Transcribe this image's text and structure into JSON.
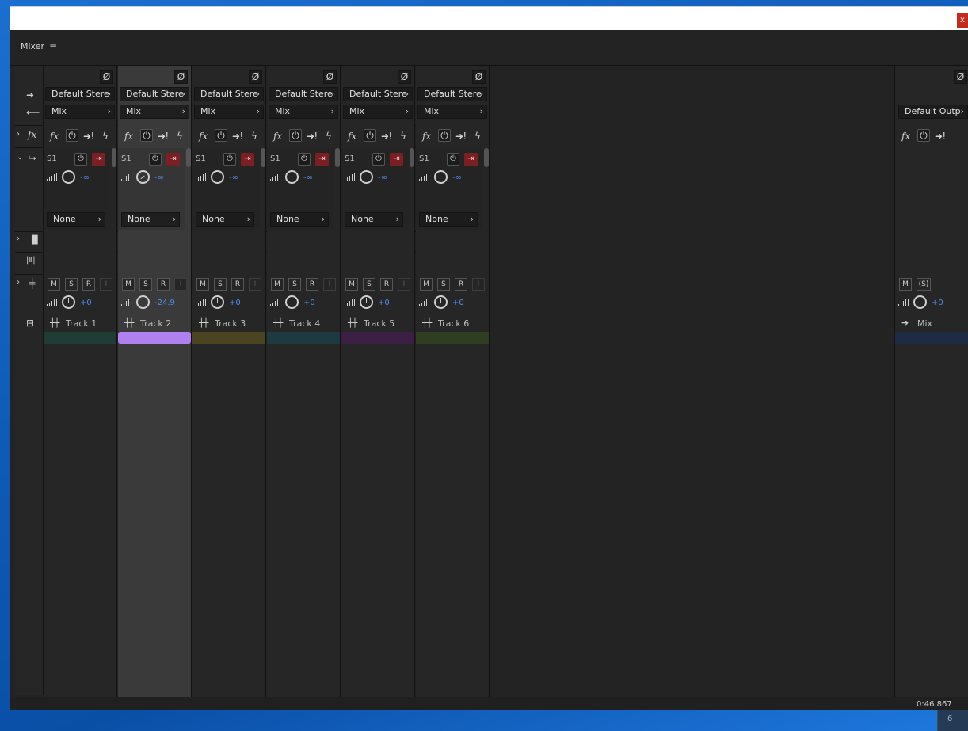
{
  "window": {
    "close_label": "x"
  },
  "panel": {
    "title": "Mixer",
    "menu_icon": "hamburger-icon"
  },
  "labels": {
    "output_arrow": "→",
    "input_arrow": "←",
    "fx": "fx",
    "sends": "send-icon",
    "eq": "eq-icon",
    "wave": "waveform-icon",
    "fader": "fader-icon",
    "track": "track-name-icon"
  },
  "tracks": [
    {
      "name": "Track 1",
      "output": "Default Stere",
      "input": "Mix",
      "send_label": "S1",
      "send_value": "-∞",
      "send_dest": "None",
      "volume": "+0",
      "color": "#1f3d35",
      "selected": false,
      "solo_label": "S"
    },
    {
      "name": "Track 2",
      "output": "Default Stere",
      "input": "Mix",
      "send_label": "S1",
      "send_value": "-∞",
      "send_dest": "None",
      "volume": "-24.9",
      "color": "#b07ff0",
      "selected": true,
      "solo_label": "S"
    },
    {
      "name": "Track 3",
      "output": "Default Stere",
      "input": "Mix",
      "send_label": "S1",
      "send_value": "-∞",
      "send_dest": "None",
      "volume": "+0",
      "color": "#4a4420",
      "selected": false,
      "solo_label": "S"
    },
    {
      "name": "Track 4",
      "output": "Default Stere",
      "input": "Mix",
      "send_label": "S1",
      "send_value": "-∞",
      "send_dest": "None",
      "volume": "+0",
      "color": "#1c3a40",
      "selected": false,
      "solo_label": "S"
    },
    {
      "name": "Track 5",
      "output": "Default Stere",
      "input": "Mix",
      "send_label": "S1",
      "send_value": "-∞",
      "send_dest": "None",
      "volume": "+0",
      "color": "#3b1f45",
      "selected": false,
      "solo_label": "S"
    },
    {
      "name": "Track 6",
      "output": "Default Stere",
      "input": "Mix",
      "send_label": "S1",
      "send_value": "-∞",
      "send_dest": "None",
      "volume": "+0",
      "color": "#2f3d22",
      "selected": false,
      "solo_label": "S"
    }
  ],
  "buttons": {
    "mute": "M",
    "solo": "S",
    "record": "R",
    "input": "I",
    "power": "⏻",
    "no_input": "Ø",
    "chevron": "›"
  },
  "master": {
    "name": "Mix",
    "output": "Default Outp",
    "volume": "+0",
    "mute": "M",
    "solo": "(S)",
    "color": "#1d2b44"
  },
  "status": {
    "time": "0:46.867"
  },
  "taskbar": {
    "number": "6"
  }
}
